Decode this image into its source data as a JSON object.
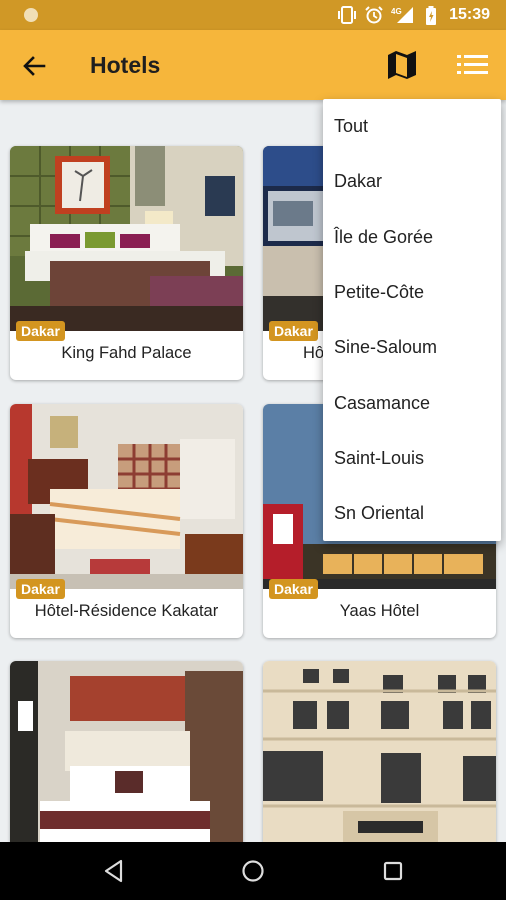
{
  "status_bar": {
    "time": "15:39",
    "network": "4G",
    "icons": [
      "notification-dot-icon",
      "vibrate-icon",
      "alarm-icon",
      "signal-icon",
      "battery-icon"
    ]
  },
  "toolbar": {
    "title": "Hotels",
    "back_icon": "arrow-left-icon",
    "map_icon": "map-icon",
    "list_icon": "list-icon",
    "background": "#f6b63b"
  },
  "hotels": [
    {
      "name": "King Fahd Palace",
      "region": "Dakar"
    },
    {
      "name": "Hô",
      "region": "Dakar"
    },
    {
      "name": "Hôtel-Résidence Kakatar",
      "region": "Dakar"
    },
    {
      "name": "Yaas Hôtel",
      "region": "Dakar"
    },
    {
      "name": "",
      "region": ""
    },
    {
      "name": "",
      "region": ""
    }
  ],
  "region_menu": {
    "items": [
      "Tout",
      "Dakar",
      "Île de Gorée",
      "Petite-Côte",
      "Sine-Saloum",
      "Casamance",
      "Saint-Louis",
      "Sn Oriental"
    ]
  },
  "nav_bar": {
    "icons": [
      "back-triangle-icon",
      "home-circle-icon",
      "recents-square-icon"
    ]
  },
  "colors": {
    "accent": "#f6b63b",
    "status_bar": "#d09826",
    "badge": "#d39520"
  }
}
